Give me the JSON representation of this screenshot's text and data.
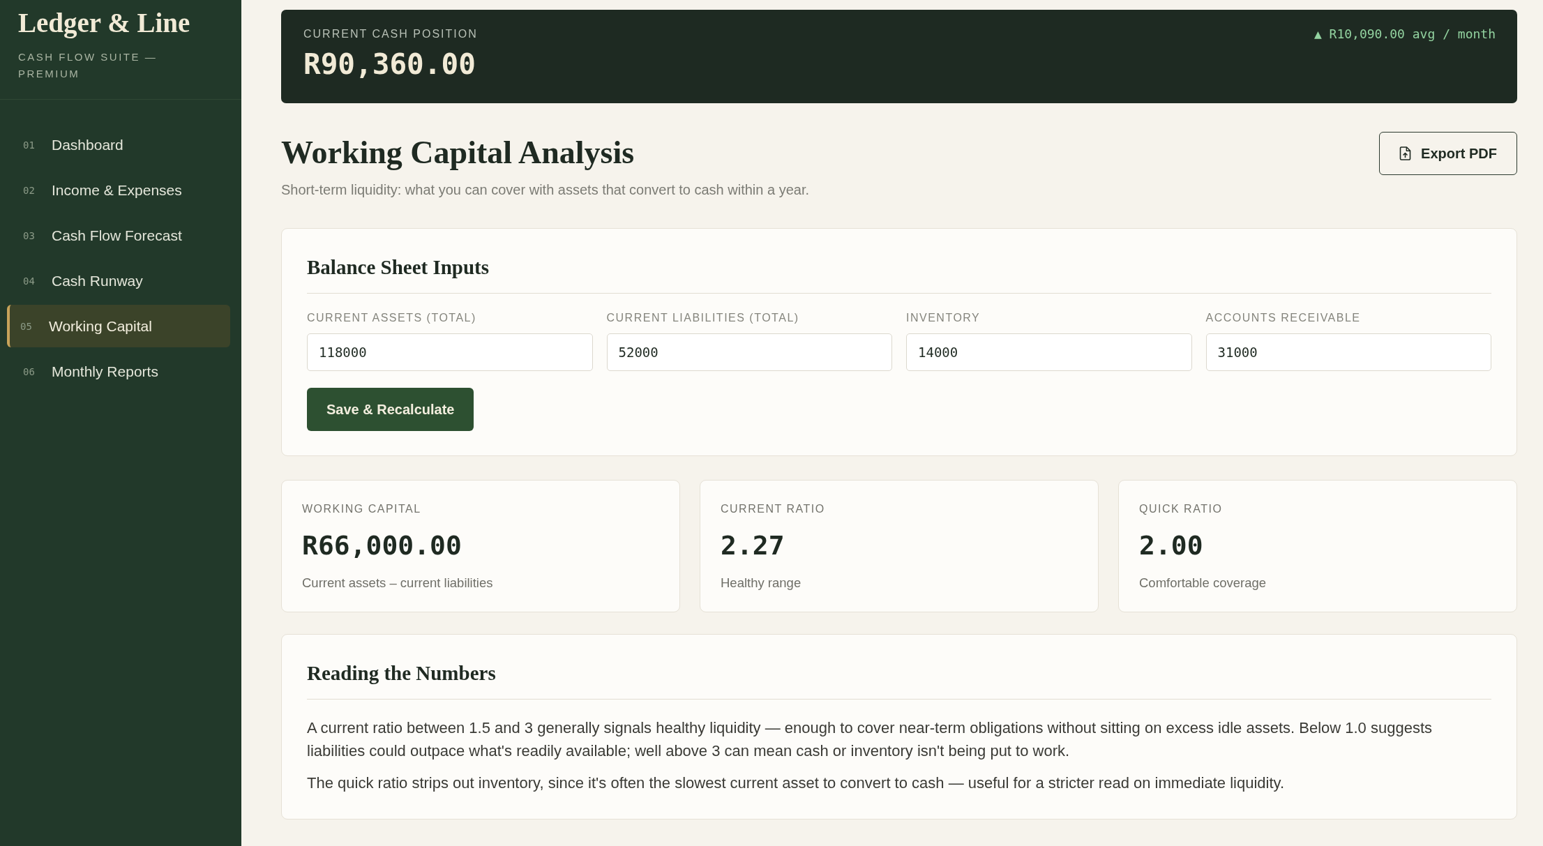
{
  "sidebar": {
    "brand": "Ledger & Line",
    "tagline": "CASH FLOW SUITE — PREMIUM",
    "items": [
      {
        "number": "01",
        "label": "Dashboard",
        "selected": false
      },
      {
        "number": "02",
        "label": "Income & Expenses",
        "selected": false
      },
      {
        "number": "03",
        "label": "Cash Flow Forecast",
        "selected": false
      },
      {
        "number": "04",
        "label": "Cash Runway",
        "selected": false
      },
      {
        "number": "05",
        "label": "Working Capital",
        "selected": true
      },
      {
        "number": "06",
        "label": "Monthly Reports",
        "selected": false
      }
    ]
  },
  "banner": {
    "label": "CURRENT CASH POSITION",
    "value": "R90,360.00",
    "trend": "▲ R10,090.00 avg / month"
  },
  "header": {
    "title": "Working Capital Analysis",
    "subtitle": "Short-term liquidity: what you can cover with assets that convert to cash within a year.",
    "export_button": "Export PDF"
  },
  "inputs_card": {
    "title": "Balance Sheet Inputs",
    "fields": [
      {
        "label": "CURRENT ASSETS (TOTAL)",
        "value": "118000"
      },
      {
        "label": "CURRENT LIABILITIES (TOTAL)",
        "value": "52000"
      },
      {
        "label": "INVENTORY",
        "value": "14000"
      },
      {
        "label": "ACCOUNTS RECEIVABLE",
        "value": "31000"
      }
    ],
    "button": "Save & Recalculate"
  },
  "metrics": [
    {
      "label": "WORKING CAPITAL",
      "value": "R66,000.00",
      "note": "Current assets – current liabilities"
    },
    {
      "label": "CURRENT RATIO",
      "value": "2.27",
      "note": "Healthy range"
    },
    {
      "label": "QUICK RATIO",
      "value": "2.00",
      "note": "Comfortable coverage"
    }
  ],
  "notes_card": {
    "title": "Reading the Numbers",
    "paragraphs": [
      "A current ratio between 1.5 and 3 generally signals healthy liquidity — enough to cover near-term obligations without sitting on excess idle assets. Below 1.0 suggests liabilities could outpace what's readily available; well above 3 can mean cash or inventory isn't being put to work.",
      "The quick ratio strips out inventory, since it's often the slowest current asset to convert to cash — useful for a stricter read on immediate liquidity."
    ]
  }
}
